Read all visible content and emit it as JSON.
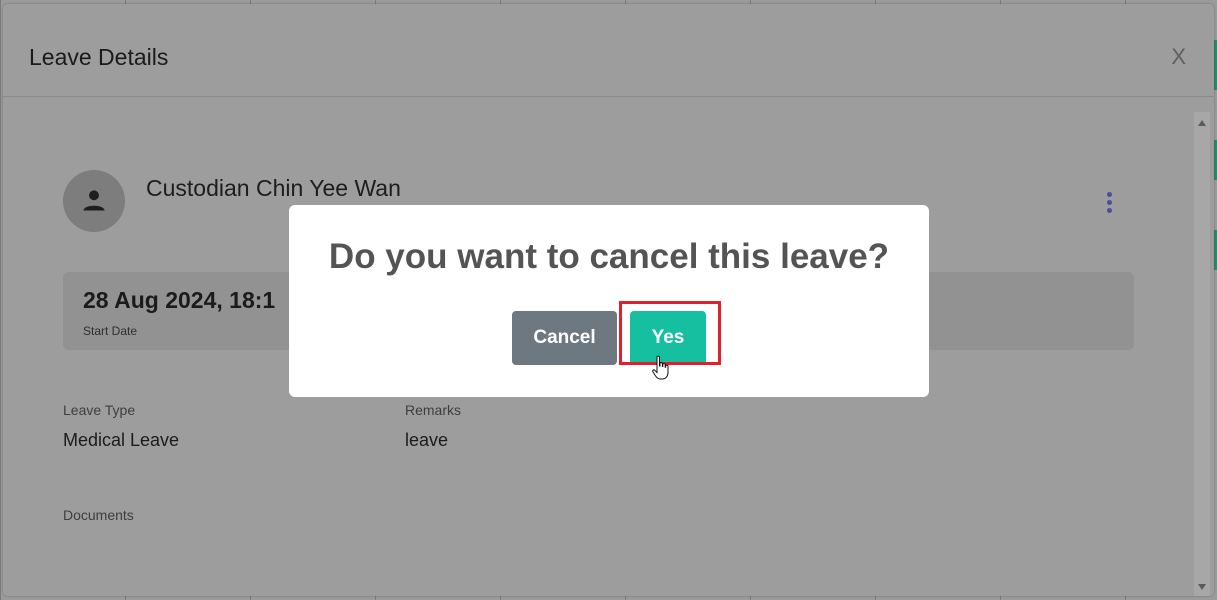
{
  "modal": {
    "title": "Leave Details",
    "close_label": "X"
  },
  "employee": {
    "name": "Custodian Chin Yee Wan"
  },
  "leave": {
    "start_date_value": "28 Aug 2024, 18:1",
    "start_date_label": "Start Date",
    "leave_type_label": "Leave Type",
    "leave_type_value": "Medical Leave",
    "remarks_label": "Remarks",
    "remarks_value": "leave",
    "documents_label": "Documents"
  },
  "confirm_dialog": {
    "question": "Do you want to cancel this leave?",
    "cancel_label": "Cancel",
    "yes_label": "Yes"
  },
  "colors": {
    "yes_button": "#16bfa0",
    "cancel_button": "#6e7881",
    "highlight": "#e0202c"
  },
  "icons": {
    "avatar": "person-icon",
    "more": "more-vertical-icon",
    "cursor": "hand-pointer-icon"
  }
}
